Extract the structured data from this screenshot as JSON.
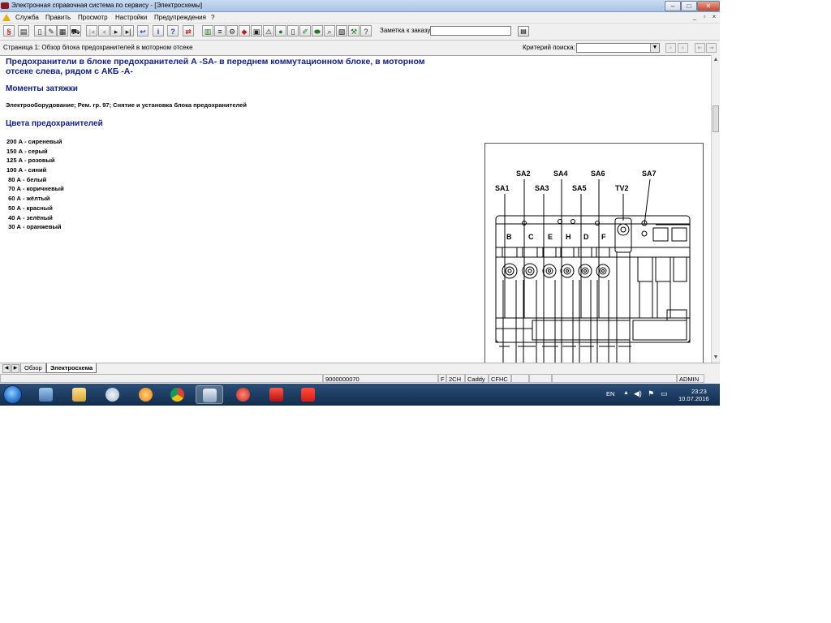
{
  "window": {
    "title": "Электронная справочная система по сервису - [Электросхемы]"
  },
  "menu": {
    "items": [
      "Служба",
      "Править",
      "Просмотр",
      "Настройки",
      "Предупреждения",
      "?"
    ]
  },
  "toolbar": {
    "note_label": "Заметка к заказу:",
    "note_value": ""
  },
  "page": {
    "title": "Страница 1: Обзор блока предохранителей в моторном отсеке",
    "search_label": "Критерий поиска:",
    "search_value": ""
  },
  "content": {
    "main_heading": "Предохранители в блоке предохранителей А -SA- в переднем коммутационном блоке, в моторном отсеке слева, рядом с АКБ -A-",
    "torque_heading": "Моменты затяжки",
    "torque_text": "Электрооборудование; Рем. гр. 97; Снятие и установка блока предохранителей",
    "colors_heading": "Цвета предохранителей",
    "fuse_colors": [
      "200 А - сиреневый",
      "150 А - серый",
      "125 А - розовый",
      "100 А - синий",
      " 80 А - белый",
      " 70 А - коричневый",
      " 60 А - жёлтый",
      " 50 А - красный",
      " 40 А - зелёный",
      " 30 А - оранжевый"
    ]
  },
  "diagram": {
    "top_labels": [
      "SA2",
      "SA4",
      "SA6",
      "SA7"
    ],
    "mid_labels": [
      "SA1",
      "SA3",
      "SA5",
      "TV2"
    ],
    "slot_labels": [
      "B",
      "C",
      "E",
      "H",
      "D",
      "F"
    ]
  },
  "tabs": [
    {
      "label": "Обзор",
      "active": false
    },
    {
      "label": "Электросхема",
      "active": true
    }
  ],
  "status": {
    "code": "9000000070",
    "f": "F",
    "engine": "2CH",
    "model": "Caddy",
    "variant": "CFHC",
    "user": "ADMIN"
  },
  "taskbar": {
    "lang": "EN",
    "time": "23:23",
    "date": "10.07.2016"
  }
}
